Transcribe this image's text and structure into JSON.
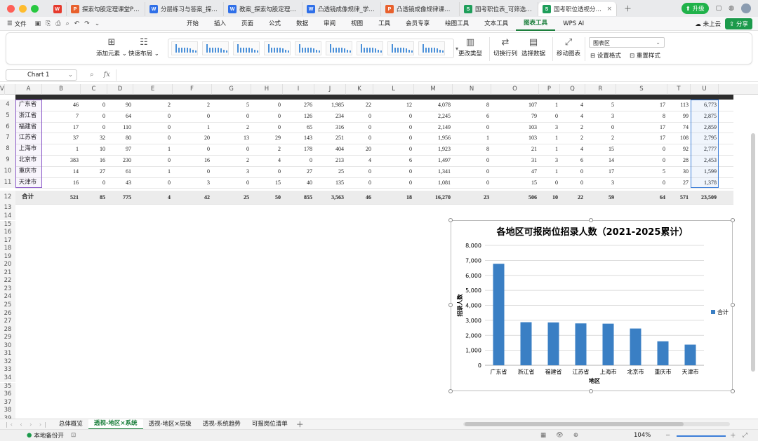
{
  "tabs": [
    {
      "type": "p",
      "label": "探索勾股定理课堂PPT.pptx"
    },
    {
      "type": "w",
      "label": "分层练习与答案_探索勾股定理.docx"
    },
    {
      "type": "w",
      "label": "教案_探索勾股定理.docx"
    },
    {
      "type": "w",
      "label": "凸透镜成像规律_学生实验报告.docx"
    },
    {
      "type": "p",
      "label": "凸透镜成像规律课堂讲义.pptx"
    },
    {
      "type": "s",
      "label": "国考职位表_可筛选.xlsx"
    },
    {
      "type": "s",
      "label": "国考职位透视分析.xlsx"
    }
  ],
  "titlebar": {
    "upgrade": "升级"
  },
  "menu": {
    "file": "文件",
    "items": [
      "开始",
      "插入",
      "页面",
      "公式",
      "数据",
      "审阅",
      "视图",
      "工具",
      "会员专享",
      "绘图工具",
      "文本工具",
      "图表工具",
      "WPS AI"
    ],
    "active": "图表工具",
    "cloud": "未上云",
    "share": "分享"
  },
  "ribbon": {
    "add_element": "添加元素",
    "quick_layout": "快速布局",
    "change_type": "更改类型",
    "switch_rowcol": "切换行列",
    "select_data": "选择数据",
    "move_chart": "移动图表",
    "chart_area": "图表区",
    "format": "设置格式",
    "reset_style": "重置样式"
  },
  "namebox": "Chart 1",
  "columns": [
    "A",
    "B",
    "C",
    "D",
    "E",
    "F",
    "G",
    "H",
    "I",
    "J",
    "K",
    "L",
    "M",
    "N",
    "O",
    "P",
    "Q",
    "R",
    "S",
    "T",
    "U",
    "V"
  ],
  "rows": [
    {
      "n": "4",
      "cells": [
        "广东省",
        "46",
        "0",
        "90",
        "2",
        "2",
        "5",
        "0",
        "276",
        "1,985",
        "22",
        "12",
        "4,078",
        "8",
        "107",
        "1",
        "4",
        "5",
        "17",
        "113",
        "6,773"
      ]
    },
    {
      "n": "5",
      "cells": [
        "浙江省",
        "7",
        "0",
        "64",
        "0",
        "0",
        "0",
        "0",
        "126",
        "234",
        "0",
        "0",
        "2,245",
        "6",
        "79",
        "0",
        "4",
        "3",
        "8",
        "99",
        "2,875"
      ]
    },
    {
      "n": "6",
      "cells": [
        "福建省",
        "17",
        "0",
        "110",
        "0",
        "1",
        "2",
        "0",
        "65",
        "316",
        "0",
        "0",
        "2,149",
        "0",
        "103",
        "3",
        "2",
        "0",
        "17",
        "74",
        "2,859"
      ]
    },
    {
      "n": "7",
      "cells": [
        "江苏省",
        "37",
        "32",
        "80",
        "0",
        "20",
        "13",
        "29",
        "143",
        "251",
        "0",
        "0",
        "1,956",
        "1",
        "103",
        "1",
        "2",
        "2",
        "17",
        "108",
        "2,795"
      ]
    },
    {
      "n": "8",
      "cells": [
        "上海市",
        "1",
        "10",
        "97",
        "1",
        "0",
        "0",
        "2",
        "178",
        "404",
        "20",
        "0",
        "1,923",
        "8",
        "21",
        "1",
        "4",
        "15",
        "0",
        "92",
        "2,777"
      ]
    },
    {
      "n": "9",
      "cells": [
        "北京市",
        "383",
        "16",
        "230",
        "0",
        "16",
        "2",
        "4",
        "0",
        "213",
        "4",
        "6",
        "1,497",
        "0",
        "31",
        "3",
        "6",
        "14",
        "0",
        "28",
        "2,453"
      ]
    },
    {
      "n": "10",
      "cells": [
        "重庆市",
        "14",
        "27",
        "61",
        "1",
        "0",
        "3",
        "0",
        "27",
        "25",
        "0",
        "0",
        "1,341",
        "0",
        "47",
        "1",
        "0",
        "17",
        "5",
        "30",
        "1,599"
      ]
    },
    {
      "n": "11",
      "cells": [
        "天津市",
        "16",
        "0",
        "43",
        "0",
        "3",
        "0",
        "15",
        "40",
        "135",
        "0",
        "0",
        "1,081",
        "0",
        "15",
        "0",
        "0",
        "3",
        "0",
        "27",
        "1,378"
      ]
    },
    {
      "n": "12",
      "cells": [
        "合计",
        "521",
        "85",
        "775",
        "4",
        "42",
        "25",
        "50",
        "855",
        "3,563",
        "46",
        "18",
        "16,270",
        "23",
        "506",
        "10",
        "22",
        "59",
        "64",
        "571",
        "23,509"
      ]
    }
  ],
  "empty_rows": [
    "13",
    "14",
    "15",
    "16",
    "17",
    "18",
    "19",
    "20",
    "21",
    "22",
    "23",
    "24",
    "25",
    "26",
    "27",
    "28",
    "29",
    "30",
    "31",
    "32",
    "33",
    "34",
    "35",
    "36",
    "37",
    "38",
    "39"
  ],
  "sheets": [
    "总体概览",
    "透视-地区×系统",
    "透视-地区×层级",
    "透视-系统趋势",
    "可报岗位清单"
  ],
  "active_sheet": "透视-地区×系统",
  "status": {
    "backup": "本地备份开",
    "zoom": "104%"
  },
  "chart_data": {
    "type": "bar",
    "title": "各地区可报岗位招录人数（2021-2025累计）",
    "xlabel": "地区",
    "ylabel": "招录人数",
    "categories": [
      "广东省",
      "浙江省",
      "福建省",
      "江苏省",
      "上海市",
      "北京市",
      "重庆市",
      "天津市"
    ],
    "series": [
      {
        "name": "合计",
        "values": [
          6773,
          2875,
          2859,
          2795,
          2777,
          2453,
          1599,
          1378
        ]
      }
    ],
    "ylim": [
      0,
      8000
    ],
    "yticks": [
      "0",
      "1,000",
      "2,000",
      "3,000",
      "4,000",
      "5,000",
      "6,000",
      "7,000",
      "8,000"
    ],
    "legend": "right",
    "grid": true,
    "color": "#3a7fc4"
  }
}
